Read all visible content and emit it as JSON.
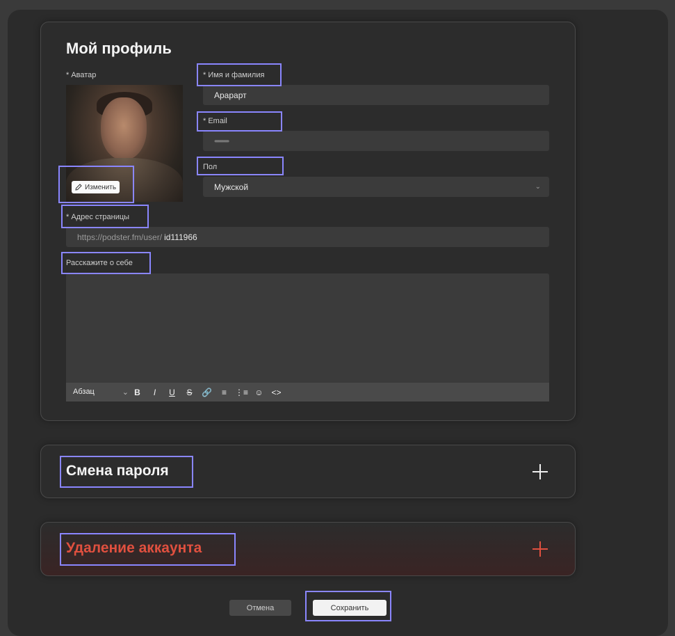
{
  "profile": {
    "title": "Мой профиль",
    "avatar_label": "* Аватар",
    "edit_label": "Изменить",
    "name_label": "* Имя и фамилия",
    "name_value": "Арарарт",
    "email_label": "* Email",
    "email_value": "••••••••••••••••",
    "gender_label": "Пол",
    "gender_value": "Мужской",
    "page_label": "* Адрес страницы",
    "page_prefix": "https://podster.fm/user/",
    "page_value": "id111966",
    "about_label": "Расскажите о себе",
    "about_value": ""
  },
  "editor": {
    "block_type": "Абзац",
    "tools": [
      "bold-icon",
      "italic-icon",
      "underline-icon",
      "strikethrough-icon",
      "link-icon",
      "numbered-list-icon",
      "bulleted-list-icon",
      "emoji-icon",
      "code-icon"
    ]
  },
  "password": {
    "title": "Смена пароля"
  },
  "delete": {
    "title": "Удаление аккаунта",
    "color": "#e0503f"
  },
  "actions": {
    "cancel": "Отмена",
    "save": "Сохранить"
  },
  "highlight_color": "#8a86ff"
}
